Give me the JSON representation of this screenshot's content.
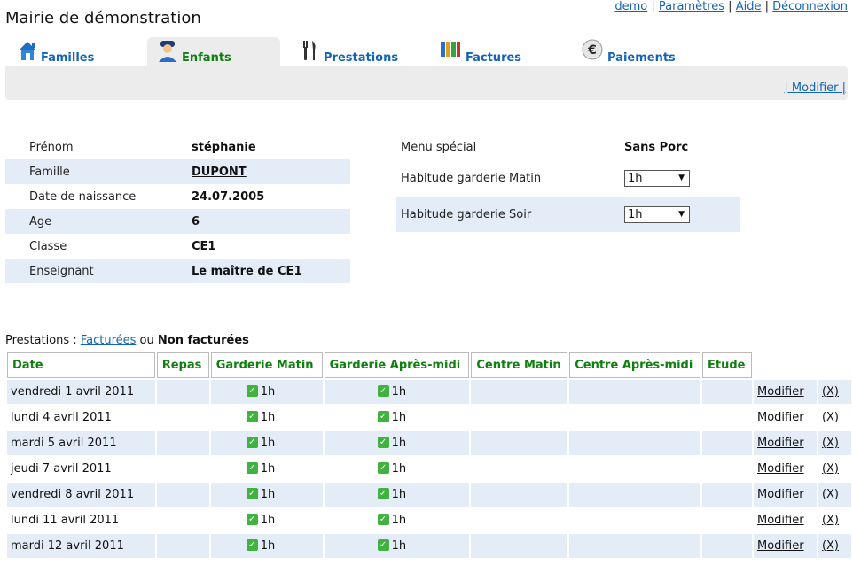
{
  "header": {
    "title": "Mairie de démonstration",
    "links": [
      "demo",
      "Paramètres",
      "Aide",
      "Déconnexion"
    ],
    "separator": "|"
  },
  "tabs": [
    {
      "label": "Familles",
      "icon": "house-icon",
      "active": false
    },
    {
      "label": "Enfants",
      "icon": "child-icon",
      "active": true
    },
    {
      "label": "Prestations",
      "icon": "cutlery-icon",
      "active": false
    },
    {
      "label": "Factures",
      "icon": "binders-icon",
      "active": false
    },
    {
      "label": "Paiements",
      "icon": "euro-icon",
      "active": false
    }
  ],
  "subbar": {
    "modify_link": "| Modifier |"
  },
  "child_info": [
    {
      "label": "Prénom",
      "value": "stéphanie"
    },
    {
      "label": "Famille",
      "value": "DUPONT"
    },
    {
      "label": "Date de naissance",
      "value": "24.07.2005"
    },
    {
      "label": "Age",
      "value": "6"
    },
    {
      "label": "Classe",
      "value": "CE1"
    },
    {
      "label": "Enseignant",
      "value": "Le maître de CE1"
    }
  ],
  "habits": {
    "menu_label": "Menu spécial",
    "menu_value": "Sans Porc",
    "morning_label": "Habitude garderie Matin",
    "morning_value": "1h",
    "evening_label": "Habitude garderie Soir",
    "evening_value": "1h"
  },
  "prestations": {
    "caption_prefix": "Prestations :",
    "link_invoiced": "Facturées",
    "or": "ou",
    "not_invoiced": "Non facturées",
    "columns": [
      "Date",
      "Repas",
      "Garderie Matin",
      "Garderie Après-midi",
      "Centre Matin",
      "Centre Après-midi",
      "Etude"
    ],
    "modify_label": "Modifier",
    "delete_label": "(X)",
    "rows": [
      {
        "date": "vendredi 1 avril 2011",
        "morning": "1h",
        "afternoon": "1h"
      },
      {
        "date": "lundi 4 avril 2011",
        "morning": "1h",
        "afternoon": "1h"
      },
      {
        "date": "mardi 5 avril 2011",
        "morning": "1h",
        "afternoon": "1h"
      },
      {
        "date": "jeudi 7 avril 2011",
        "morning": "1h",
        "afternoon": "1h"
      },
      {
        "date": "vendredi 8 avril 2011",
        "morning": "1h",
        "afternoon": "1h"
      },
      {
        "date": "lundi 11 avril 2011",
        "morning": "1h",
        "afternoon": "1h"
      },
      {
        "date": "mardi 12 avril 2011",
        "morning": "1h",
        "afternoon": "1h"
      }
    ]
  },
  "colors": {
    "link": "#1464b4",
    "active_tab": "#0f7f0f",
    "column_header": "#0f7f0f",
    "row_alt": "#e4ecf8",
    "check": "#3fb23f"
  }
}
